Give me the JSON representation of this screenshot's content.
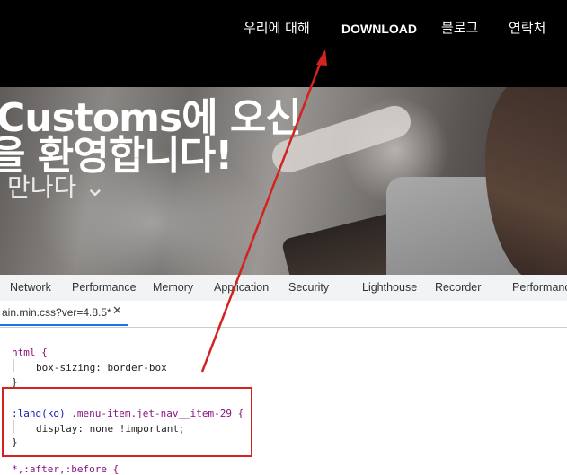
{
  "nav": {
    "items": [
      {
        "label": "우리에 대해",
        "bold": false
      },
      {
        "label": "DOWNLOAD",
        "bold": true
      },
      {
        "label": "블로그",
        "bold": false
      },
      {
        "label": "연락처",
        "bold": false
      }
    ]
  },
  "hero": {
    "line1": "Customs에 오신",
    "line2": "을 환영합니다!",
    "line3": "만나다 ⌄"
  },
  "devtools": {
    "tabs": [
      "Network",
      "Performance",
      "Memory",
      "Application",
      "Security",
      "Lighthouse",
      "Recorder",
      "Performance"
    ],
    "file_tab": "ain.min.css?ver=4.8.5*",
    "close_glyph": "✕",
    "code": {
      "rule1_selector": "html {",
      "rule1_decl": "box-sizing: border-box",
      "rule1_close": "}",
      "rule2_selector_lang": ":lang(ko)",
      "rule2_selector_rest": " .menu-item.jet-nav__item-29 {",
      "rule2_decl_prop": "display:",
      "rule2_decl_val": " none !important;",
      "rule2_close": "}",
      "rule3_selector": "*,:after,:before {"
    }
  },
  "annotation": {
    "color": "#d2231f"
  }
}
